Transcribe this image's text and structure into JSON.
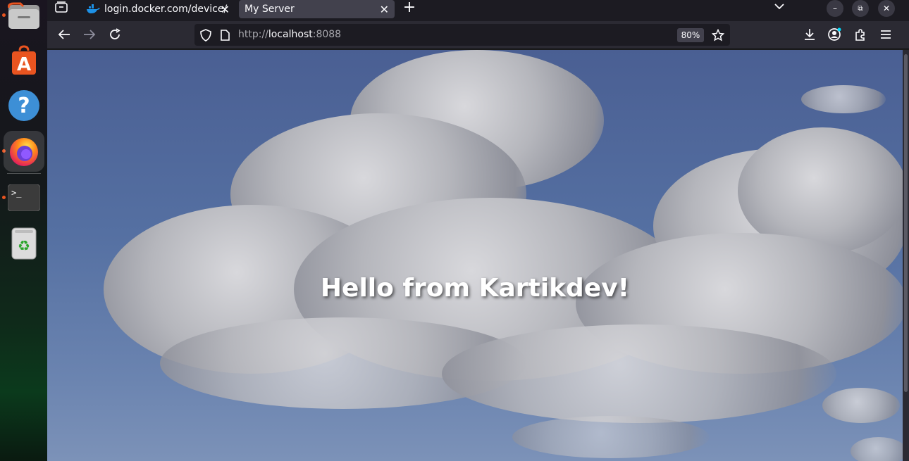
{
  "dock": {
    "items": [
      {
        "name": "files",
        "icon": "folder-icon"
      },
      {
        "name": "app-center",
        "icon": "app-center-icon"
      },
      {
        "name": "help",
        "icon": "help-icon",
        "glyph": "?"
      },
      {
        "name": "firefox",
        "icon": "firefox-icon"
      },
      {
        "name": "terminal",
        "icon": "terminal-icon",
        "glyph": ">_"
      },
      {
        "name": "trash",
        "icon": "trash-icon",
        "glyph": "♻"
      }
    ]
  },
  "browser": {
    "tabs": [
      {
        "label": "login.docker.com/device/",
        "selected": false
      },
      {
        "label": "My Server",
        "selected": true
      }
    ],
    "new_tab_glyph": "+",
    "url": {
      "scheme": "http://",
      "host": "localhost",
      "port": ":8088"
    },
    "zoom": "80%"
  },
  "page": {
    "heading": "Hello from Kartikdev!"
  },
  "colors": {
    "sky": "#4a5f93",
    "chrome": "#2b2a33",
    "tabbar": "#1c1b22",
    "accent_dot": "#e95420"
  }
}
